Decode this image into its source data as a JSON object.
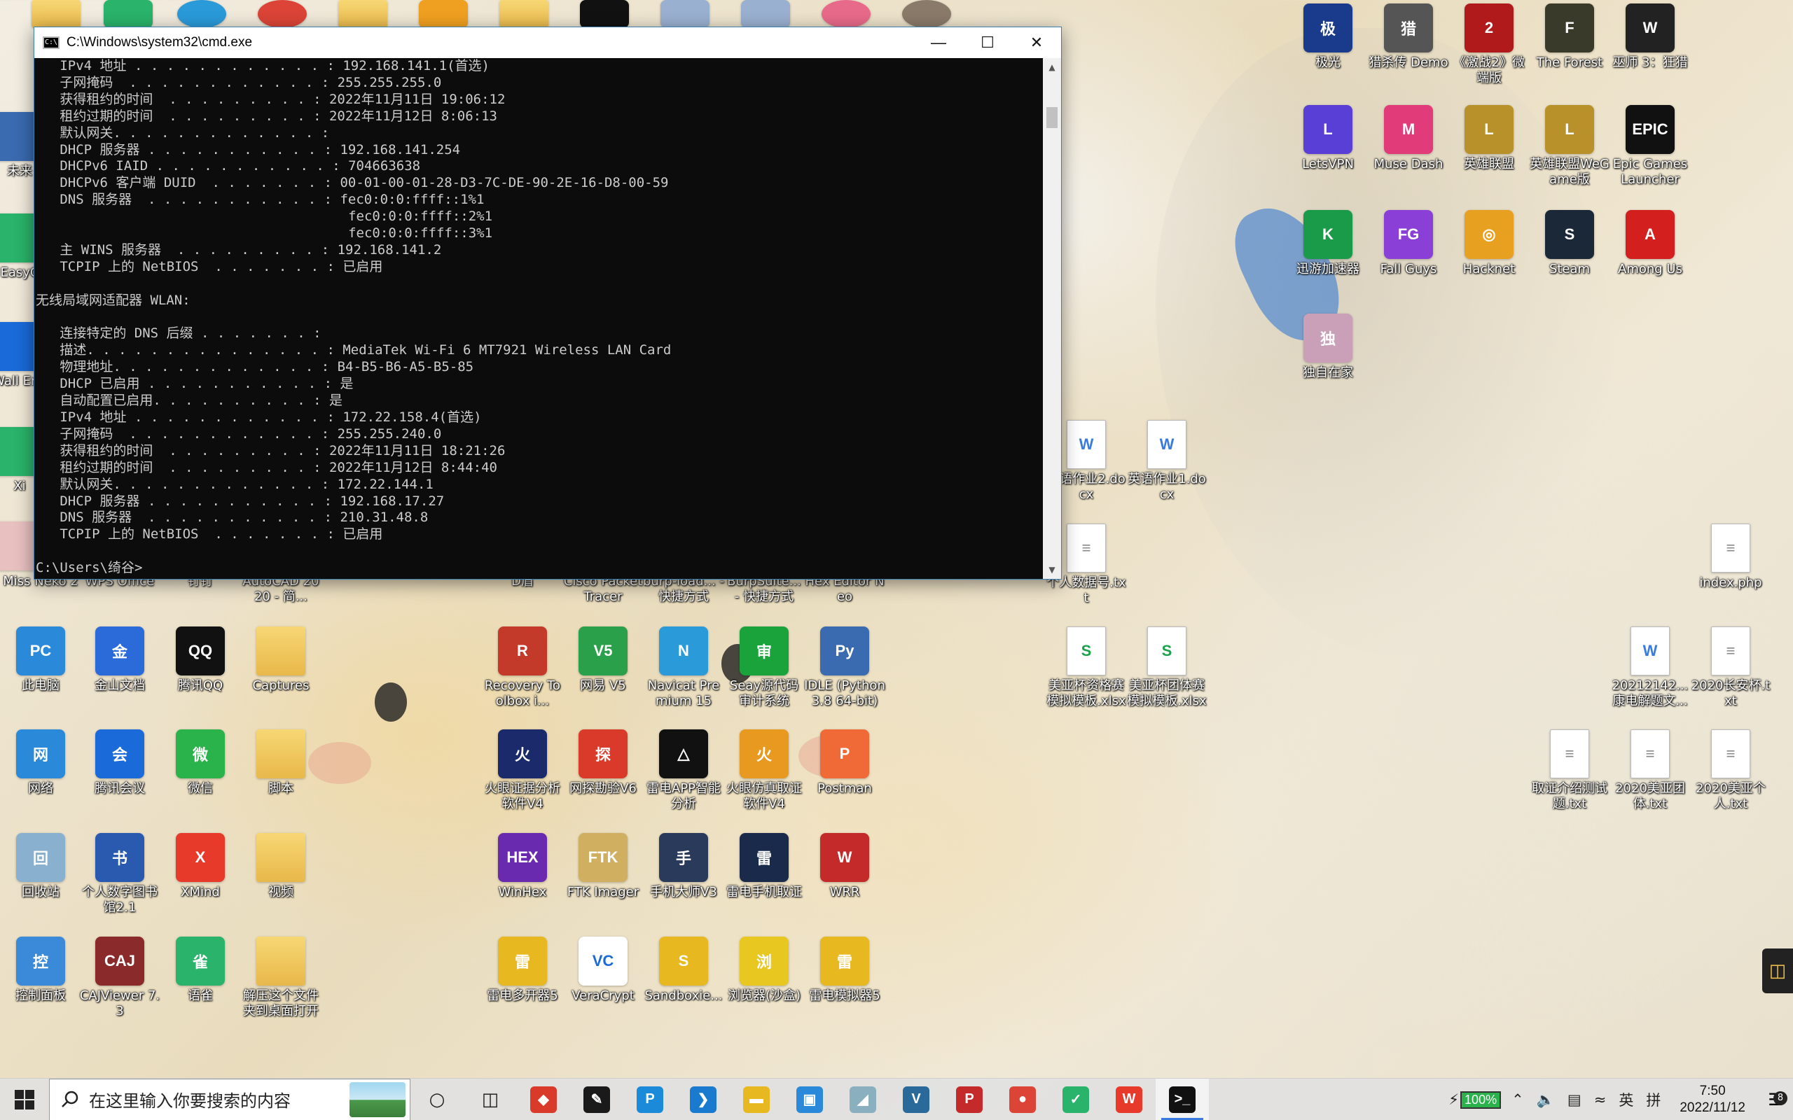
{
  "cmd": {
    "title": "C:\\Windows\\system32\\cmd.exe",
    "lines": [
      "   IPv4 地址 . . . . . . . . . . . . : 192.168.141.1(首选)",
      "   子网掩码  . . . . . . . . . . . . : 255.255.255.0",
      "   获得租约的时间  . . . . . . . . . : 2022年11月11日 19:06:12",
      "   租约过期的时间  . . . . . . . . . : 2022年11月12日 8:06:13",
      "   默认网关. . . . . . . . . . . . . :",
      "   DHCP 服务器 . . . . . . . . . . . : 192.168.141.254",
      "   DHCPv6 IAID . . . . . . . . . . . : 704663638",
      "   DHCPv6 客户端 DUID  . . . . . . . : 00-01-00-01-28-D3-7C-DE-90-2E-16-D8-00-59",
      "   DNS 服务器  . . . . . . . . . . . : fec0:0:0:ffff::1%1",
      "                                       fec0:0:0:ffff::2%1",
      "                                       fec0:0:0:ffff::3%1",
      "   主 WINS 服务器  . . . . . . . . . : 192.168.141.2",
      "   TCPIP 上的 NetBIOS  . . . . . . . : 已启用",
      "",
      "无线局域网适配器 WLAN:",
      "",
      "   连接特定的 DNS 后缀 . . . . . . . :",
      "   描述. . . . . . . . . . . . . . . : MediaTek Wi-Fi 6 MT7921 Wireless LAN Card",
      "   物理地址. . . . . . . . . . . . . : B4-B5-B6-A5-B5-85",
      "   DHCP 已启用 . . . . . . . . . . . : 是",
      "   自动配置已启用. . . . . . . . . . : 是",
      "   IPv4 地址 . . . . . . . . . . . . : 172.22.158.4(首选)",
      "   子网掩码  . . . . . . . . . . . . : 255.255.240.0",
      "   获得租约的时间  . . . . . . . . . : 2022年11月11日 18:21:26",
      "   租约过期的时间  . . . . . . . . . : 2022年11月12日 8:44:40",
      "   默认网关. . . . . . . . . . . . . : 172.22.144.1",
      "   DHCP 服务器 . . . . . . . . . . . : 192.168.17.27",
      "   DNS 服务器  . . . . . . . . . . . : 210.31.48.8",
      "   TCPIP 上的 NetBIOS  . . . . . . . : 已启用",
      "",
      "C:\\Users\\绮谷>"
    ]
  },
  "desktop_icons_right": [
    {
      "label": "极光",
      "color": "#1a3a8c",
      "glyph": "极"
    },
    {
      "label": "猎杀传 Demo",
      "color": "#555",
      "glyph": "猎"
    },
    {
      "label": "《激战2》微端版",
      "color": "#b01a1a",
      "glyph": "2"
    },
    {
      "label": "The Forest",
      "color": "#3a3a2a",
      "glyph": "F"
    },
    {
      "label": "巫师 3：狂猎",
      "color": "#222",
      "glyph": "W"
    },
    {
      "label": "LetsVPN",
      "color": "#5a3fd6",
      "glyph": "L"
    },
    {
      "label": "Muse Dash",
      "color": "#e23b7a",
      "glyph": "M"
    },
    {
      "label": "英雄联盟",
      "color": "#b8912a",
      "glyph": "L"
    },
    {
      "label": "英雄联盟WeGame版",
      "color": "#b8912a",
      "glyph": "L"
    },
    {
      "label": "Epic Games Launcher",
      "color": "#111",
      "glyph": "EPIC"
    },
    {
      "label": "迅游加速器",
      "color": "#1a9b4a",
      "glyph": "K"
    },
    {
      "label": "Fall Guys",
      "color": "#8a3fd6",
      "glyph": "FG"
    },
    {
      "label": "Hacknet",
      "color": "#e8a020",
      "glyph": "◎"
    },
    {
      "label": "Steam",
      "color": "#1b2838",
      "glyph": "S"
    },
    {
      "label": "Among Us",
      "color": "#d41f1f",
      "glyph": "A"
    },
    {
      "label": "独自在家",
      "color": "#c9a0b8",
      "glyph": "独"
    }
  ],
  "desktop_icons_left_partial": [
    {
      "label": "Miss Neko 2"
    },
    {
      "label": "WPS Office"
    },
    {
      "label": "钉钉"
    },
    {
      "label": "AutoCAD 2020 - 简..."
    },
    {
      "label": "D盾"
    },
    {
      "label": "Cisco Packet Tracer"
    },
    {
      "label": "burp-load... - 快捷方式"
    },
    {
      "label": "BurpSuite... - 快捷方式"
    },
    {
      "label": "Hex Editor Neo"
    }
  ],
  "desktop_grid": [
    {
      "label": "此电脑",
      "color": "#2a8ad9",
      "glyph": "PC"
    },
    {
      "label": "金山文档",
      "color": "#2a6ad9",
      "glyph": "金"
    },
    {
      "label": "腾讯QQ",
      "color": "#111",
      "glyph": "QQ"
    },
    {
      "label": "Captures",
      "color": "folder",
      "glyph": ""
    },
    {
      "label": "Recovery Toolbox i...",
      "color": "#c43a2a",
      "glyph": "R"
    },
    {
      "label": "网易 V5",
      "color": "#2aa04a",
      "glyph": "V5"
    },
    {
      "label": "Navicat Premium 15",
      "color": "#2a9ad9",
      "glyph": "N"
    },
    {
      "label": "Seay源代码审计系统",
      "color": "#1aa33a",
      "glyph": "审"
    },
    {
      "label": "IDLE (Python 3.8 64-bit)",
      "color": "#3a6ab0",
      "glyph": "Py"
    },
    {
      "label": "网络",
      "color": "#2a8ad9",
      "glyph": "网"
    },
    {
      "label": "腾讯会议",
      "color": "#1a6ad9",
      "glyph": "会"
    },
    {
      "label": "微信",
      "color": "#2ab34a",
      "glyph": "微"
    },
    {
      "label": "脚本",
      "color": "folder",
      "glyph": ""
    },
    {
      "label": "火眼证据分析软件V4",
      "color": "#1a2a6a",
      "glyph": "火"
    },
    {
      "label": "网探勘验V6",
      "color": "#d93a2a",
      "glyph": "探"
    },
    {
      "label": "雷电APP智能分析",
      "color": "#111",
      "glyph": "△"
    },
    {
      "label": "火眼仿真取证软件V4",
      "color": "#e89a20",
      "glyph": "火"
    },
    {
      "label": "Postman",
      "color": "#ef6a36",
      "glyph": "P"
    },
    {
      "label": "回收站",
      "color": "#8ab0d0",
      "glyph": "回"
    },
    {
      "label": "个人数字图书馆2.1",
      "color": "#2a5ab0",
      "glyph": "书"
    },
    {
      "label": "XMind",
      "color": "#e83a2a",
      "glyph": "X"
    },
    {
      "label": "视频",
      "color": "folder",
      "glyph": ""
    },
    {
      "label": "WinHex",
      "color": "#6a2ab0",
      "glyph": "HEX"
    },
    {
      "label": "FTK Imager",
      "color": "#d0b060",
      "glyph": "FTK"
    },
    {
      "label": "手机大师V3",
      "color": "#2a3a5a",
      "glyph": "手"
    },
    {
      "label": "雷电手机取证",
      "color": "#1a2a4a",
      "glyph": "雷"
    },
    {
      "label": "WRR",
      "color": "#c42a2a",
      "glyph": "W"
    },
    {
      "label": "控制面板",
      "color": "#3a8ad9",
      "glyph": "控"
    },
    {
      "label": "CAJViewer 7.3",
      "color": "#8a2a2a",
      "glyph": "CAJ"
    },
    {
      "label": "语雀",
      "color": "#2ab36a",
      "glyph": "雀"
    },
    {
      "label": "解压这个文件夹到桌面打开",
      "color": "folder",
      "glyph": ""
    },
    {
      "label": "雷电多开器5",
      "color": "#e8b820",
      "glyph": "雷"
    },
    {
      "label": "VeraCrypt",
      "color": "#fff",
      "glyph": "VC"
    },
    {
      "label": "Sandboxie...",
      "color": "#e8b820",
      "glyph": "S"
    },
    {
      "label": "浏览器(沙盒)",
      "color": "#e8c820",
      "glyph": "浏"
    },
    {
      "label": "雷电模拟器5",
      "color": "#e8b820",
      "glyph": "雷"
    }
  ],
  "desktop_docs": [
    {
      "label": "英语作业2.docx",
      "type": "doc"
    },
    {
      "label": "英语作业1.docx",
      "type": "doc"
    },
    {
      "label": "个人数据号.txt",
      "type": "txt"
    },
    {
      "label": "美亚杯资格赛模拟模板.xlsx",
      "type": "xls"
    },
    {
      "label": "美亚杯团体赛模拟模板.xlsx",
      "type": "xls"
    },
    {
      "label": "index.php",
      "type": "txt"
    },
    {
      "label": "20212142...康电解题文...",
      "type": "doc"
    },
    {
      "label": "2020长安杯.txt",
      "type": "txt"
    },
    {
      "label": "取证介绍测试题.txt",
      "type": "txt"
    },
    {
      "label": "2020美亚团体.txt",
      "type": "txt"
    },
    {
      "label": "2020美亚个人.txt",
      "type": "txt"
    }
  ],
  "left_edge_labels": [
    "未来",
    "EasyC",
    "Wall Eng",
    "Xi"
  ],
  "taskbar": {
    "search_placeholder": "在这里输入你要搜索的内容",
    "apps": [
      {
        "name": "redirect-app",
        "color": "#d93a2a",
        "glyph": "◆"
      },
      {
        "name": "pen-app",
        "color": "#1a1a1a",
        "glyph": "✎"
      },
      {
        "name": "pycharm-app",
        "color": "#1a8ad9",
        "glyph": "P"
      },
      {
        "name": "vscode-app",
        "color": "#1a7ad0",
        "glyph": "❯"
      },
      {
        "name": "explorer-app",
        "color": "#e8b820",
        "glyph": "▬"
      },
      {
        "name": "window-app",
        "color": "#2a8ad9",
        "glyph": "▣"
      },
      {
        "name": "eraser-app",
        "color": "#8ab0c0",
        "glyph": "◢"
      },
      {
        "name": "veracrypt-app",
        "color": "#2a6a9a",
        "glyph": "V"
      },
      {
        "name": "pdf-app",
        "color": "#c42a2a",
        "glyph": "P"
      },
      {
        "name": "chrome-app",
        "color": "#db4437",
        "glyph": "●"
      },
      {
        "name": "yuque-app",
        "color": "#2ab36a",
        "glyph": "✓"
      },
      {
        "name": "wps-app",
        "color": "#e83a2a",
        "glyph": "W"
      },
      {
        "name": "cmd-app",
        "color": "#111",
        "glyph": ">_"
      }
    ],
    "battery": "100%",
    "ime": "英",
    "ime_mode": "拼",
    "time": "7:50",
    "date": "2022/11/12",
    "notifications": "8"
  }
}
